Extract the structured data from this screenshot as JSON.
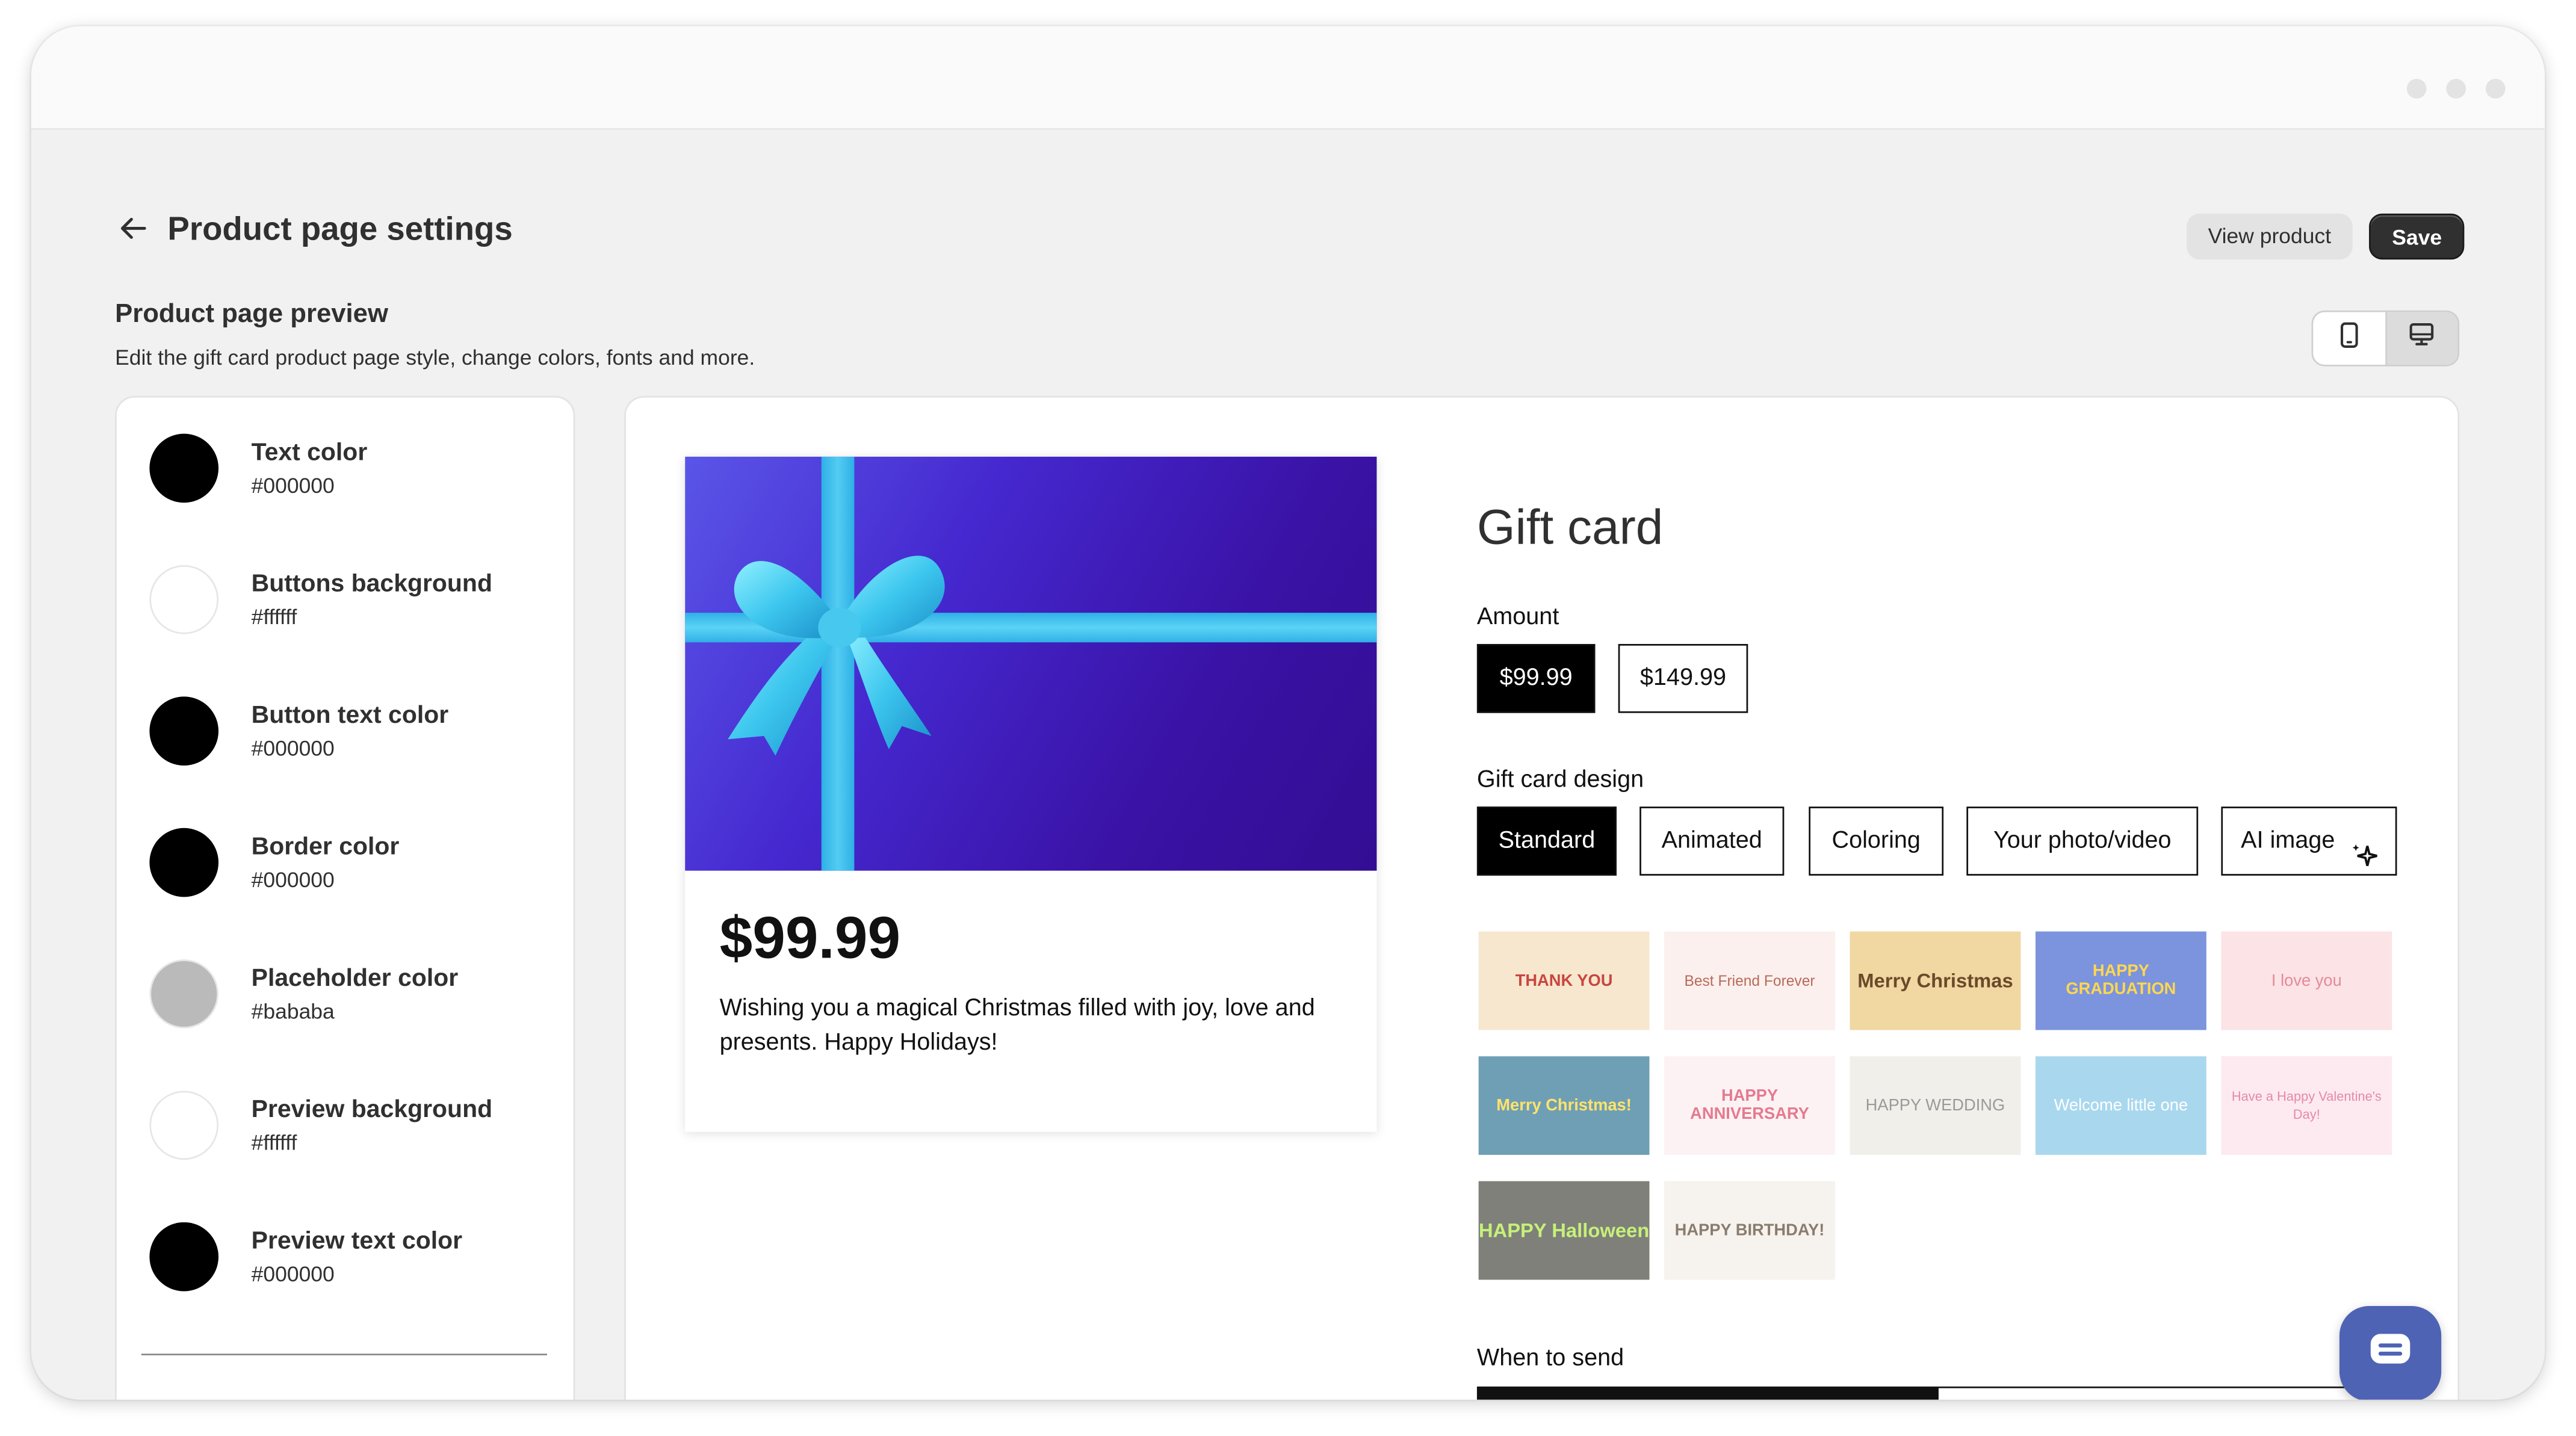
{
  "header": {
    "back_icon": "arrow-left-icon",
    "title": "Product page settings",
    "view_product_label": "View product",
    "save_label": "Save"
  },
  "preview_section": {
    "title": "Product page preview",
    "subtitle": "Edit the gift card product page style, change colors, fonts and more.",
    "device_toggle": [
      "mobile-icon",
      "desktop-icon"
    ],
    "active_device": "desktop"
  },
  "colors": [
    {
      "label": "Text color",
      "value": "#000000"
    },
    {
      "label": "Buttons background",
      "value": "#ffffff"
    },
    {
      "label": "Button text color",
      "value": "#000000"
    },
    {
      "label": "Border color",
      "value": "#000000"
    },
    {
      "label": "Placeholder color",
      "value": "#bababa"
    },
    {
      "label": "Preview background",
      "value": "#ffffff"
    },
    {
      "label": "Preview text color",
      "value": "#000000"
    }
  ],
  "preview": {
    "card_price": "$99.99",
    "card_message": "Wishing you a magical Christmas filled with joy, love and presents. Happy Holidays!",
    "product_title": "Gift card",
    "amount_label": "Amount",
    "amounts": [
      "$99.99",
      "$149.99"
    ],
    "selected_amount": "$99.99",
    "design_label": "Gift card design",
    "design_tabs": [
      "Standard",
      "Animated",
      "Coloring",
      "Your photo/video",
      "AI image"
    ],
    "selected_design_tab": "Standard",
    "designs": [
      {
        "text": "THANK YOU",
        "bg": "#f7e7cf",
        "fg": "#c8463f"
      },
      {
        "text": "Best Friend Forever",
        "bg": "#fbf0ee",
        "fg": "#b86a5a"
      },
      {
        "text": "Merry Christmas",
        "bg": "#f1d7a2",
        "fg": "#6a4a2a"
      },
      {
        "text": "HAPPY GRADUATION",
        "bg": "#7c93de",
        "fg": "#ffd84d"
      },
      {
        "text": "I love you",
        "bg": "#fbe3e6",
        "fg": "#e48a98"
      },
      {
        "text": "Merry Christmas!",
        "bg": "#6f9fb5",
        "fg": "#ffe36b"
      },
      {
        "text": "HAPPY ANNIVERSARY",
        "bg": "#fdf2f3",
        "fg": "#e57a8f"
      },
      {
        "text": "HAPPY WEDDING",
        "bg": "#f1efea",
        "fg": "#9a9a9a"
      },
      {
        "text": "Welcome little one",
        "bg": "#a9d8ee",
        "fg": "#ffffff"
      },
      {
        "text": "Have a Happy Valentine's Day!",
        "bg": "#fdeaf0",
        "fg": "#e48aa8"
      },
      {
        "text": "HAPPY Halloween",
        "bg": "#7e8079",
        "fg": "#c6f07a"
      },
      {
        "text": "HAPPY BIRTHDAY!",
        "bg": "#f6f3ee",
        "fg": "#8a7c6e"
      }
    ],
    "when_label": "When to send"
  },
  "chat_icon": "chat-icon"
}
